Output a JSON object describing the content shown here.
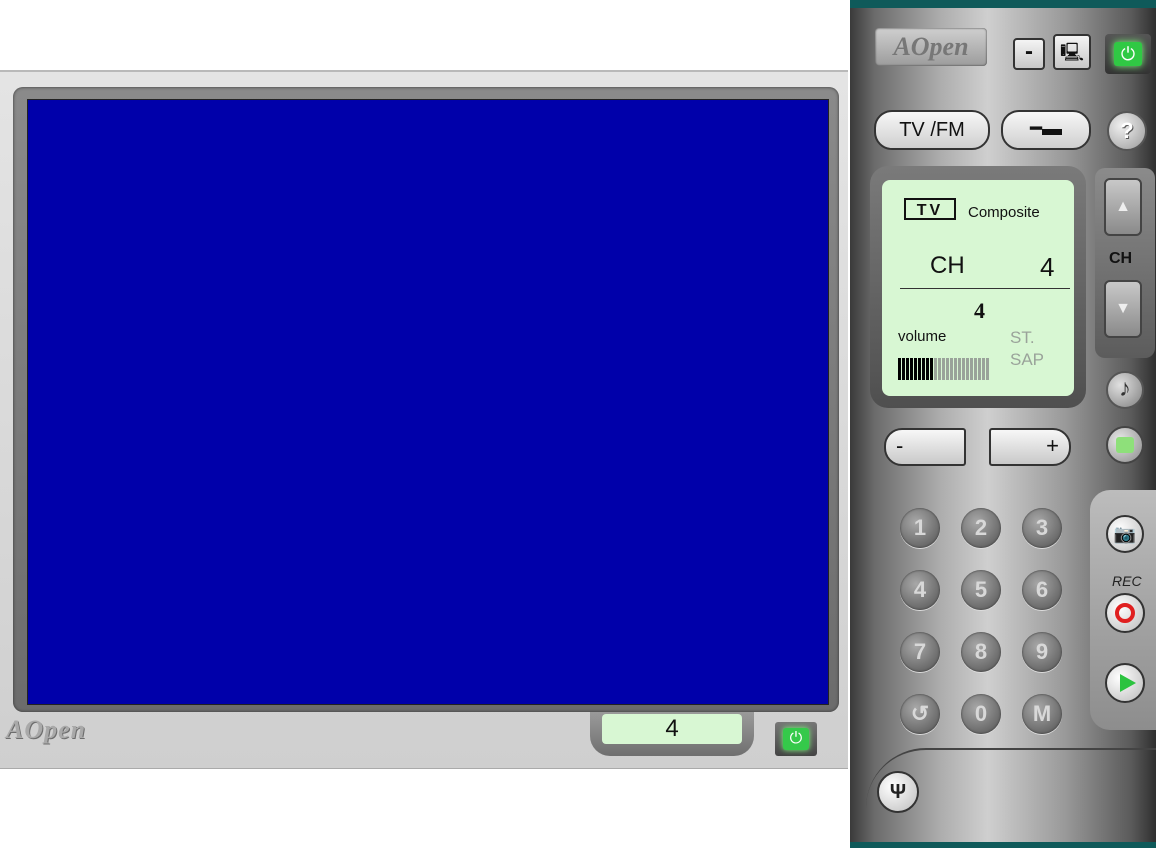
{
  "tv": {
    "logo": "AOpen",
    "channel_display": "4"
  },
  "remote": {
    "logo": "AOpen",
    "minimize_label": "-",
    "tvfm_label": "TV /FM",
    "help_label": "?",
    "lcd": {
      "source_badge": "TV",
      "source_name": "Composite",
      "ch_label": "CH",
      "ch_value": "4",
      "volume_value": "4",
      "volume_label": "volume",
      "stereo_label": "ST.",
      "sap_label": "SAP",
      "volume_level": 0.4
    },
    "ch_label": "CH",
    "vol_minus_label": "-",
    "vol_plus_label": "+",
    "keypad": [
      "1",
      "2",
      "3",
      "4",
      "5",
      "6",
      "7",
      "8",
      "9",
      "↺",
      "0",
      "M"
    ],
    "rec_label": "REC"
  },
  "colors": {
    "screen_blue": "#0000aa",
    "lcd_green": "#d8f7d3",
    "power_green": "#30c944",
    "record_red": "#e02020"
  },
  "icons": [
    "minimize-icon",
    "display-settings-icon",
    "power-icon",
    "cable-plug-icon",
    "help-icon",
    "chevron-up-icon",
    "chevron-down-icon",
    "music-note-icon",
    "speaker-icon",
    "camera-icon",
    "record-icon",
    "play-icon",
    "wrench-icon"
  ]
}
